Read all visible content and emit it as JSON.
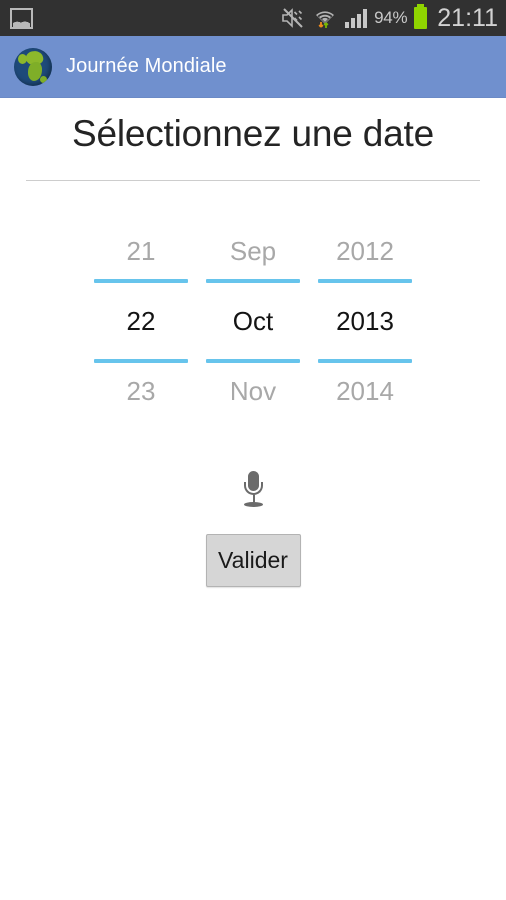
{
  "status_bar": {
    "gallery_icon": "gallery-icon",
    "mute_icon": "mute-vibrate-icon",
    "wifi_icon": "wifi-data-icon",
    "signal_icon": "cellular-signal-icon",
    "battery_percent": "94%",
    "battery_icon": "battery-icon",
    "time": "21:11",
    "background_color": "#313131",
    "text_color": "#c9c9c9",
    "battery_color": "#8fd400"
  },
  "app_bar": {
    "logo_icon": "globe-icon",
    "title": "Journée Mondiale",
    "background_color": "#7090ce",
    "title_color": "#ffffff"
  },
  "page": {
    "title": "Sélectionnez une date",
    "divider_color": "#cdcdcd"
  },
  "date_picker": {
    "selection_line_color": "#67c4ec",
    "dim_text_color": "#a8a8a8",
    "selected_text_color": "#141414",
    "columns": [
      {
        "name": "day",
        "previous": "21",
        "current": "22",
        "next": "23"
      },
      {
        "name": "month",
        "previous": "Sep",
        "current": "Oct",
        "next": "Nov"
      },
      {
        "name": "year",
        "previous": "2012",
        "current": "2013",
        "next": "2014"
      }
    ]
  },
  "voice_input": {
    "icon": "microphone-icon",
    "icon_color": "#6b6b6b"
  },
  "actions": {
    "validate_label": "Valider",
    "validate_bg_color": "#d6d6d6",
    "validate_border_color": "#b3b3b3"
  }
}
